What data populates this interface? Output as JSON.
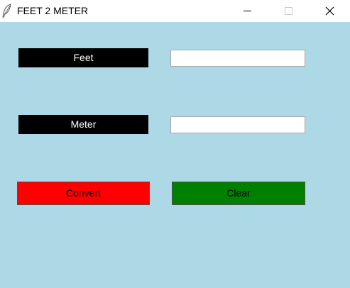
{
  "window": {
    "title": "FEET 2 METER",
    "icon": "feather-icon",
    "controls": [
      "minimize-icon",
      "maximize-icon",
      "close-icon"
    ]
  },
  "colors": {
    "client_background": "#add8e6",
    "label_background": "#000000",
    "label_text": "#ffffff",
    "convert_button": "#ff0000",
    "clear_button": "#008000"
  },
  "form": {
    "feet_label": "Feet",
    "feet_value": "",
    "meter_label": "Meter",
    "meter_value": ""
  },
  "buttons": {
    "convert_label": "Convert",
    "clear_label": "Clear"
  }
}
